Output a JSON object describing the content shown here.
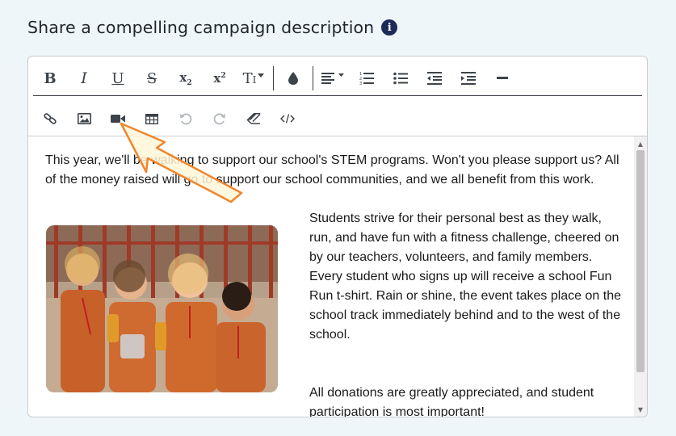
{
  "header": {
    "title": "Share a compelling campaign description",
    "info_icon": "i"
  },
  "toolbar": {
    "row1": [
      {
        "name": "bold-button",
        "icon": "bold-icon",
        "glyph": "B"
      },
      {
        "name": "italic-button",
        "icon": "italic-icon",
        "glyph": "I"
      },
      {
        "name": "underline-button",
        "icon": "underline-icon",
        "glyph": "U"
      },
      {
        "name": "strikethrough-button",
        "icon": "strikethrough-icon",
        "glyph": "S"
      },
      {
        "name": "subscript-button",
        "icon": "subscript-icon",
        "glyph": "x"
      },
      {
        "name": "superscript-button",
        "icon": "superscript-icon",
        "glyph": "x"
      },
      {
        "name": "font-size-dropdown",
        "icon": "text-size-icon",
        "glyph": "T"
      },
      {
        "name": "text-color-button",
        "icon": "droplet-icon"
      },
      {
        "name": "align-dropdown",
        "icon": "align-left-icon"
      },
      {
        "name": "ordered-list-button",
        "icon": "ordered-list-icon"
      },
      {
        "name": "unordered-list-button",
        "icon": "unordered-list-icon"
      },
      {
        "name": "outdent-button",
        "icon": "outdent-icon"
      },
      {
        "name": "indent-button",
        "icon": "indent-icon"
      },
      {
        "name": "horizontal-rule-button",
        "icon": "horizontal-rule-icon"
      }
    ],
    "row2": [
      {
        "name": "link-button",
        "icon": "link-icon"
      },
      {
        "name": "image-button",
        "icon": "image-icon"
      },
      {
        "name": "video-button",
        "icon": "video-camera-icon"
      },
      {
        "name": "table-button",
        "icon": "table-icon"
      },
      {
        "name": "undo-button",
        "icon": "undo-icon",
        "disabled": true
      },
      {
        "name": "redo-button",
        "icon": "redo-icon",
        "disabled": true
      },
      {
        "name": "clear-format-button",
        "icon": "eraser-icon"
      },
      {
        "name": "code-view-button",
        "icon": "code-icon"
      }
    ]
  },
  "content": {
    "paragraph1": "This year, we'll be walking to support our school's STEM programs. Won't you please support us? All of the money raised will go to support our school communities, and we all benefit from this work.",
    "paragraph2": "Students strive for their personal best as they walk, run, and have fun with a fitness challenge, cheered on by our teachers, volunteers, and family members. Every student who signs up will receive a school Fun Run t-shirt. Rain or shine, the event takes place on the school track immediately behind and to the west of the school.",
    "paragraph3": "All donations are greatly appreciated, and student participation is most important!"
  },
  "colors": {
    "page_background": "#eef6f9",
    "info_icon_bg": "#1e2a5a",
    "pointer_outline": "#f0862c",
    "pointer_fill": "#fff6d8"
  }
}
